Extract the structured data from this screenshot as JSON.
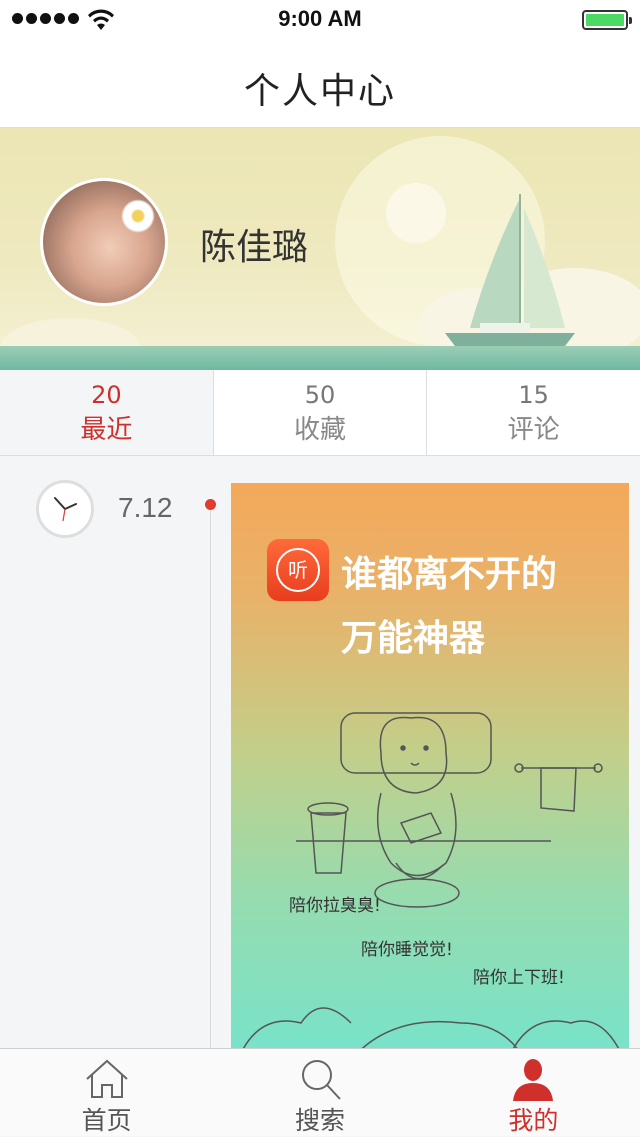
{
  "status": {
    "time": "9:00 AM",
    "signal_bars": 5,
    "battery_level": 1.0
  },
  "nav": {
    "title": "个人中心"
  },
  "profile": {
    "name": "陈佳璐"
  },
  "tabs": [
    {
      "count": "20",
      "label": "最近",
      "active": true
    },
    {
      "count": "50",
      "label": "收藏",
      "active": false
    },
    {
      "count": "15",
      "label": "评论",
      "active": false
    }
  ],
  "timeline": {
    "date": "7.12",
    "card": {
      "app_icon_text": "听",
      "headline_line1": "谁都离不开的",
      "headline_line2": "万能神器",
      "captions": [
        "陪你拉臭臭!",
        "陪你睡觉觉!",
        "陪你上下班!"
      ]
    }
  },
  "tabbar": {
    "items": [
      {
        "label": "首页",
        "icon": "home-icon",
        "active": false
      },
      {
        "label": "搜索",
        "icon": "search-icon",
        "active": false
      },
      {
        "label": "我的",
        "icon": "person-icon",
        "active": true
      }
    ]
  },
  "colors": {
    "accent": "#d0302b",
    "timeline_dot": "#e23b2e",
    "battery": "#4cd964"
  }
}
